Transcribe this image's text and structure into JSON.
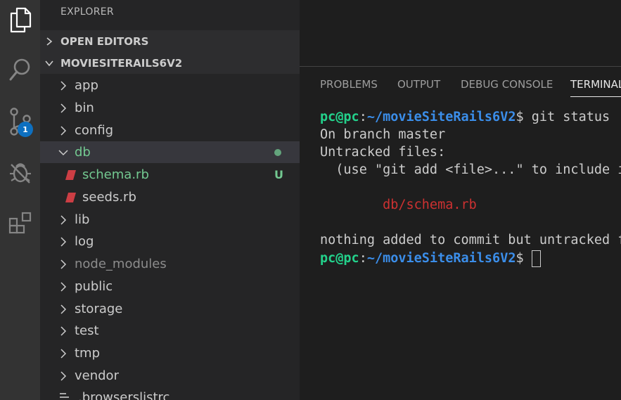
{
  "activity_bar": {
    "icons": [
      "explorer-icon",
      "search-icon",
      "source-control-icon",
      "debug-icon",
      "extensions-icon"
    ],
    "source_control_badge": "1"
  },
  "sidebar": {
    "title": "EXPLORER",
    "open_editors_label": "OPEN EDITORS",
    "project_label": "MOVIESITERAILS6V2",
    "tree": [
      {
        "label": "app",
        "kind": "folder"
      },
      {
        "label": "bin",
        "kind": "folder"
      },
      {
        "label": "config",
        "kind": "folder"
      },
      {
        "label": "db",
        "kind": "folder-open",
        "status": "dot"
      },
      {
        "label": "schema.rb",
        "kind": "ruby-file",
        "status": "U"
      },
      {
        "label": "seeds.rb",
        "kind": "ruby-file"
      },
      {
        "label": "lib",
        "kind": "folder"
      },
      {
        "label": "log",
        "kind": "folder"
      },
      {
        "label": "node_modules",
        "kind": "folder"
      },
      {
        "label": "public",
        "kind": "folder"
      },
      {
        "label": "storage",
        "kind": "folder"
      },
      {
        "label": "test",
        "kind": "folder"
      },
      {
        "label": "tmp",
        "kind": "folder"
      },
      {
        "label": "vendor",
        "kind": "folder"
      },
      {
        "label": ".browserslistrc",
        "kind": "file"
      }
    ]
  },
  "panel": {
    "tabs": [
      "PROBLEMS",
      "OUTPUT",
      "DEBUG CONSOLE",
      "TERMINAL"
    ],
    "active_tab": "TERMINAL"
  },
  "terminal": {
    "user_host": "pc@pc",
    "colon": ":",
    "path": "~/movieSiteRails6V2",
    "prompt_symbol": "$ ",
    "command": "git status",
    "line_branch": "On branch master",
    "line_untracked": "Untracked files:",
    "line_hint": "  (use \"git add <file>...\" to include in what will be committed)",
    "untracked_file": "\tdb/schema.rb",
    "line_nothing": "nothing added to commit but untracked files present (use \"git add\" to track)"
  },
  "colors": {
    "activity_bar": "#333333",
    "sidebar": "#252526",
    "editor": "#1e1e1e",
    "badge": "#0e70c0",
    "git_untracked": "#73c991",
    "ruby": "#cc3e44",
    "prompt_green": "#23d18b",
    "prompt_blue": "#3b8eea",
    "terminal_red": "#cd3131"
  }
}
